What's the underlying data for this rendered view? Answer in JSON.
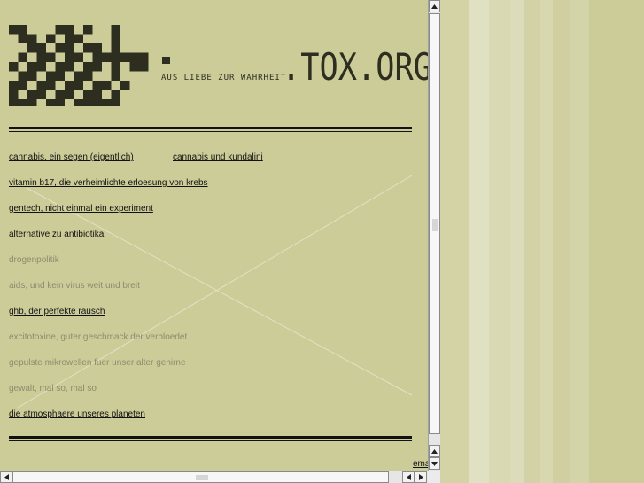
{
  "header": {
    "tagline": "AUS LIEBE ZUR WAHRHEIT",
    "brand": ".TOX.ORG"
  },
  "menu": {
    "items": [
      {
        "label": "cannabis, ein segen (eigentlich)",
        "active": true
      },
      {
        "label": "cannabis und kundalini",
        "active": true
      },
      {
        "label": "vitamin b17, die verheimlichte erloesung von krebs",
        "active": true
      },
      {
        "label": "gentech, nicht einmal ein experiment",
        "active": true
      },
      {
        "label": "alternative zu antibiotika",
        "active": true
      },
      {
        "label": "drogenpolitik",
        "active": false
      },
      {
        "label": "aids, und kein virus weit und breit",
        "active": false
      },
      {
        "label": "ghb, der perfekte rausch",
        "active": true
      },
      {
        "label": "excitotoxine, guter geschmack der verbloedet",
        "active": false
      },
      {
        "label": "gepulste mikrowellen fuer unser alter gehirne",
        "active": false
      },
      {
        "label": "gewalt, mal so, mal so",
        "active": false
      },
      {
        "label": "die atmosphaere unseres planeten",
        "active": true
      }
    ]
  },
  "footer": {
    "email_label": "ema"
  },
  "colors": {
    "background": "#cccc99",
    "ink": "#2e2e20",
    "inactive": "#8c8c6e",
    "stripes": [
      "#d3d3a6",
      "#e0e0c2",
      "#d9d9b3",
      "#dcdcba",
      "#d2d2a6",
      "#d7d7b0",
      "#cfcfa1",
      "#d4d4a9",
      "#cccc99"
    ]
  },
  "icons": {
    "logo": "pixel-arrows-logo",
    "scroll_up": "arrow-up-icon",
    "scroll_down": "arrow-down-icon",
    "scroll_left": "arrow-left-icon",
    "scroll_right": "arrow-right-icon"
  }
}
